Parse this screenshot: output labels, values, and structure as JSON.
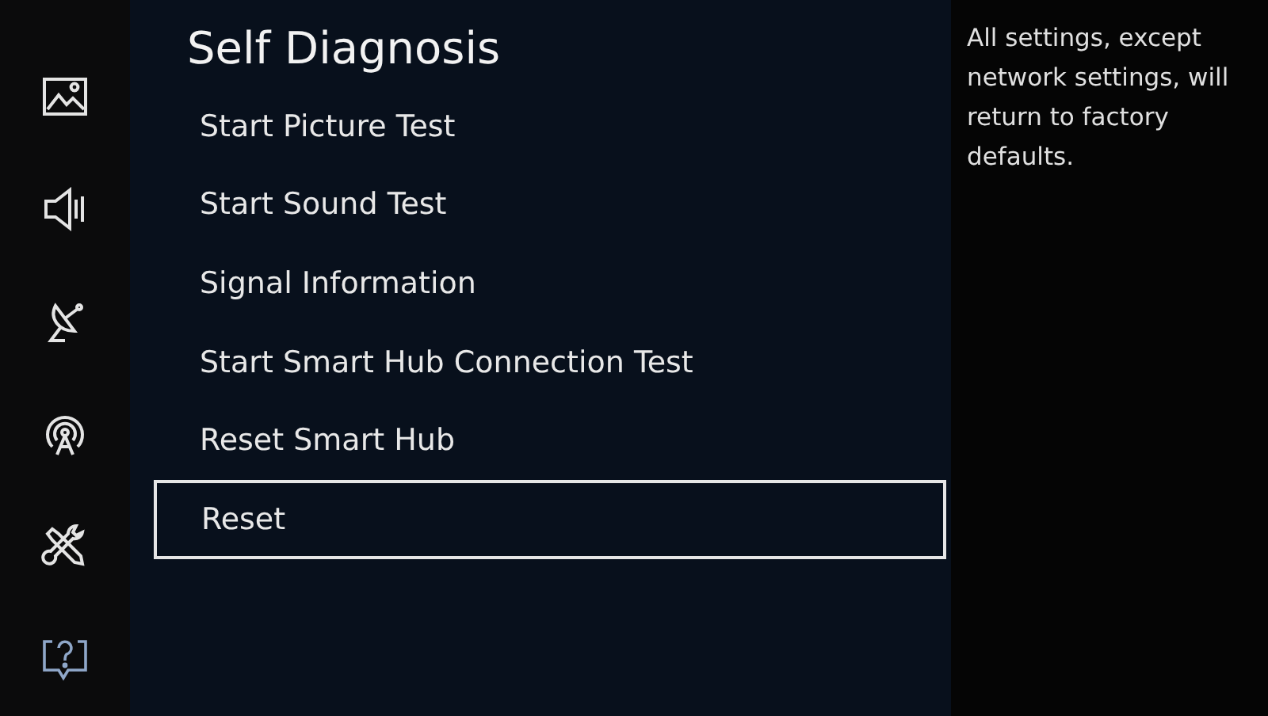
{
  "sidebar": {
    "items": [
      {
        "kind": "picture",
        "selected": false
      },
      {
        "kind": "sound",
        "selected": false
      },
      {
        "kind": "broadcasting",
        "selected": false
      },
      {
        "kind": "network",
        "selected": false
      },
      {
        "kind": "general",
        "selected": false
      },
      {
        "kind": "support",
        "selected": true
      }
    ]
  },
  "menu": {
    "title": "Self Diagnosis",
    "items": [
      {
        "label": "Start Picture Test",
        "selected": false
      },
      {
        "label": "Start Sound Test",
        "selected": false
      },
      {
        "label": "Signal Information",
        "selected": false
      },
      {
        "label": "Start Smart Hub Connection Test",
        "selected": false
      },
      {
        "label": "Reset Smart Hub",
        "selected": false
      },
      {
        "label": "Reset",
        "selected": true
      }
    ]
  },
  "description": "All settings, except network settings, will return to factory defaults."
}
